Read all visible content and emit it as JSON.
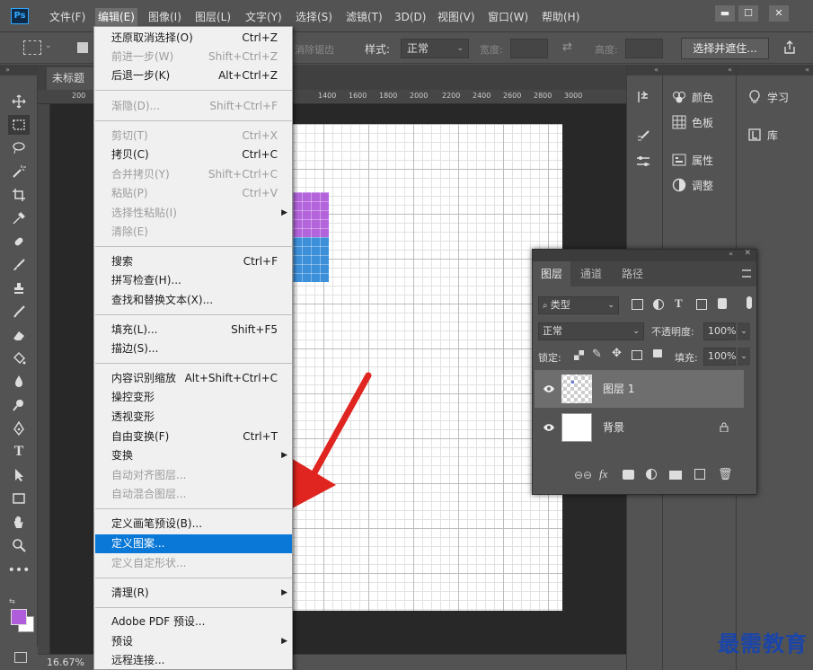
{
  "menubar": {
    "logo": "Ps",
    "items": [
      "文件(F)",
      "编辑(E)",
      "图像(I)",
      "图层(L)",
      "文字(Y)",
      "选择(S)",
      "滤镜(T)",
      "3D(D)",
      "视图(V)",
      "窗口(W)",
      "帮助(H)"
    ],
    "window_buttons": [
      "▬",
      "☐",
      "✕"
    ]
  },
  "options": {
    "feather_ghost": "消除锯齿",
    "style_label": "样式:",
    "style_value": "正常",
    "width_label": "宽度:",
    "height_label": "高度:",
    "select_mask_button": "选择并遮住..."
  },
  "document": {
    "tab_title": "未标题",
    "ruler_left": "200",
    "ruler_ticks": [
      "1400",
      "1600",
      "1800",
      "2000",
      "2200",
      "2400",
      "2600",
      "2800",
      "3000"
    ],
    "zoom": "16.67%"
  },
  "edit_menu": {
    "items": [
      {
        "label": "还原取消选择(O)",
        "shortcut": "Ctrl+Z",
        "disabled": false
      },
      {
        "label": "前进一步(W)",
        "shortcut": "Shift+Ctrl+Z",
        "disabled": true
      },
      {
        "label": "后退一步(K)",
        "shortcut": "Alt+Ctrl+Z",
        "disabled": false
      },
      {
        "label": "渐隐(D)...",
        "shortcut": "Shift+Ctrl+F",
        "disabled": true
      },
      {
        "label": "剪切(T)",
        "shortcut": "Ctrl+X",
        "disabled": true
      },
      {
        "label": "拷贝(C)",
        "shortcut": "Ctrl+C",
        "disabled": false
      },
      {
        "label": "合并拷贝(Y)",
        "shortcut": "Shift+Ctrl+C",
        "disabled": true
      },
      {
        "label": "粘贴(P)",
        "shortcut": "Ctrl+V",
        "disabled": true
      },
      {
        "label": "选择性粘贴(I)",
        "shortcut": "",
        "disabled": true
      },
      {
        "label": "清除(E)",
        "shortcut": "",
        "disabled": true
      },
      {
        "label": "搜索",
        "shortcut": "Ctrl+F",
        "disabled": false
      },
      {
        "label": "拼写检查(H)...",
        "shortcut": "",
        "disabled": false
      },
      {
        "label": "查找和替换文本(X)...",
        "shortcut": "",
        "disabled": false
      },
      {
        "label": "填充(L)...",
        "shortcut": "Shift+F5",
        "disabled": false
      },
      {
        "label": "描边(S)...",
        "shortcut": "",
        "disabled": false
      },
      {
        "label": "内容识别缩放",
        "shortcut": "Alt+Shift+Ctrl+C",
        "disabled": false
      },
      {
        "label": "操控变形",
        "shortcut": "",
        "disabled": false
      },
      {
        "label": "透视变形",
        "shortcut": "",
        "disabled": false
      },
      {
        "label": "自由变换(F)",
        "shortcut": "Ctrl+T",
        "disabled": false
      },
      {
        "label": "变换",
        "shortcut": "",
        "disabled": false
      },
      {
        "label": "自动对齐图层...",
        "shortcut": "",
        "disabled": true
      },
      {
        "label": "自动混合图层...",
        "shortcut": "",
        "disabled": true
      },
      {
        "label": "定义画笔预设(B)...",
        "shortcut": "",
        "disabled": false
      },
      {
        "label": "定义图案...",
        "shortcut": "",
        "disabled": false
      },
      {
        "label": "定义自定形状...",
        "shortcut": "",
        "disabled": true
      },
      {
        "label": "清理(R)",
        "shortcut": "",
        "disabled": false
      },
      {
        "label": "Adobe PDF 预设...",
        "shortcut": "",
        "disabled": false
      },
      {
        "label": "预设",
        "shortcut": "",
        "disabled": false
      },
      {
        "label": "远程连接...",
        "shortcut": "",
        "disabled": false
      }
    ]
  },
  "panels": {
    "color": "颜色",
    "swatches": "色板",
    "properties": "属性",
    "adjustments": "调整",
    "learn": "学习",
    "libraries": "库"
  },
  "layers_panel": {
    "tabs": [
      "图层",
      "通道",
      "路径"
    ],
    "filter_kind": "类型",
    "blend_mode": "正常",
    "opacity_label": "不透明度:",
    "opacity_value": "100%",
    "lock_label": "锁定:",
    "fill_label": "填充:",
    "fill_value": "100%",
    "layers": [
      {
        "name": "图层 1",
        "selected": true
      },
      {
        "name": "背景",
        "selected": false
      }
    ]
  },
  "watermark": "最需教育",
  "colors": {
    "foreground": "#b05ddb",
    "background": "#ffffff",
    "purple_cells": "#b05ddb",
    "blue_cells": "#3c8fd9",
    "highlight": "#0a78d7",
    "arrow": "#e0241f"
  }
}
